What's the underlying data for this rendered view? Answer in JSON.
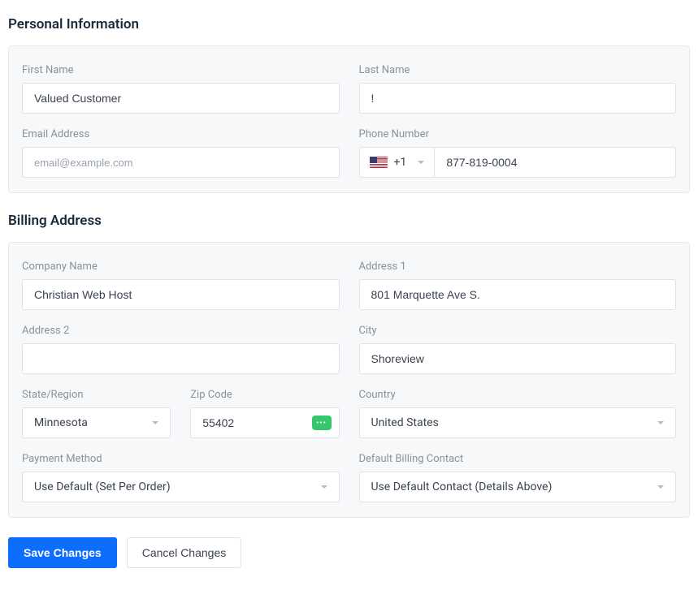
{
  "sections": {
    "personal": {
      "title": "Personal Information"
    },
    "billing": {
      "title": "Billing Address"
    }
  },
  "personal": {
    "first_name": {
      "label": "First Name",
      "value": "Valued Customer"
    },
    "last_name": {
      "label": "Last Name",
      "value": "!"
    },
    "email": {
      "label": "Email Address",
      "value": "",
      "placeholder": "email@example.com"
    },
    "phone": {
      "label": "Phone Number",
      "cc": "+1",
      "value": "877-819-0004"
    }
  },
  "billing": {
    "company": {
      "label": "Company Name",
      "value": "Christian Web Host"
    },
    "address1": {
      "label": "Address 1",
      "value": "801 Marquette Ave S."
    },
    "address2": {
      "label": "Address 2",
      "value": ""
    },
    "city": {
      "label": "City",
      "value": "Shoreview"
    },
    "state": {
      "label": "State/Region",
      "value": "Minnesota"
    },
    "zip": {
      "label": "Zip Code",
      "value": "55402"
    },
    "country": {
      "label": "Country",
      "value": "United States"
    },
    "payment": {
      "label": "Payment Method",
      "value": "Use Default (Set Per Order)"
    },
    "default_contact": {
      "label": "Default Billing Contact",
      "value": "Use Default Contact (Details Above)"
    }
  },
  "actions": {
    "save": "Save Changes",
    "cancel": "Cancel Changes"
  }
}
